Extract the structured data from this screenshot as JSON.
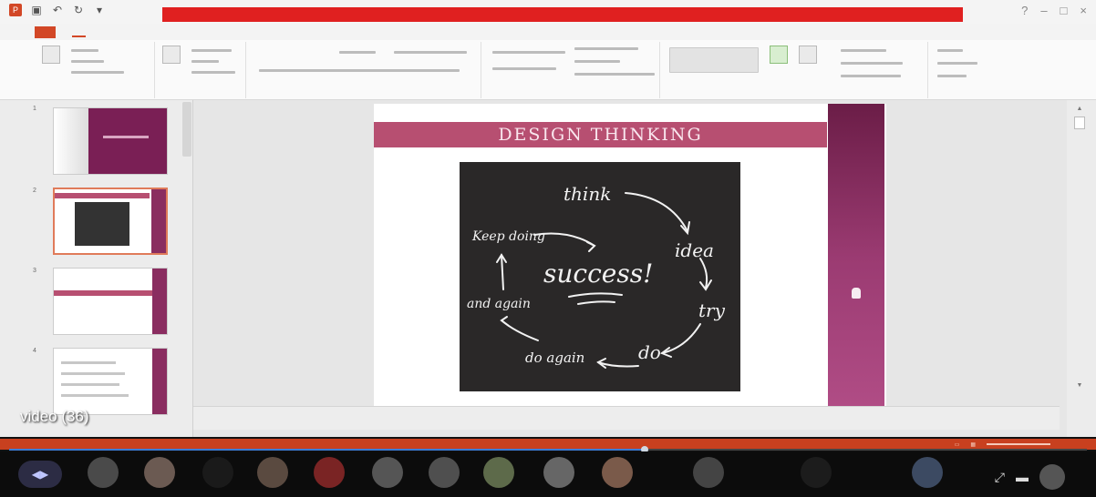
{
  "video_label": "video (36)",
  "slide": {
    "title": "DESIGN THINKING",
    "board_words": [
      "think",
      "idea",
      "try",
      "do",
      "do again",
      "and again",
      "Keep doing",
      "success!"
    ]
  },
  "colors": {
    "accent": "#d24726",
    "banner": "#b74f71",
    "side_bar": "#8a2d60",
    "red_bar": "#e02020"
  },
  "thumbnails": [
    {
      "num": "1"
    },
    {
      "num": "2"
    },
    {
      "num": "3"
    },
    {
      "num": "4"
    }
  ],
  "playback": {
    "progress_fraction": 0.59
  },
  "icons": [
    "powerpoint-icon",
    "save-icon",
    "undo-icon",
    "redo-icon",
    "customize-icon",
    "cursor-icon",
    "mic-icon",
    "expand-icon"
  ]
}
